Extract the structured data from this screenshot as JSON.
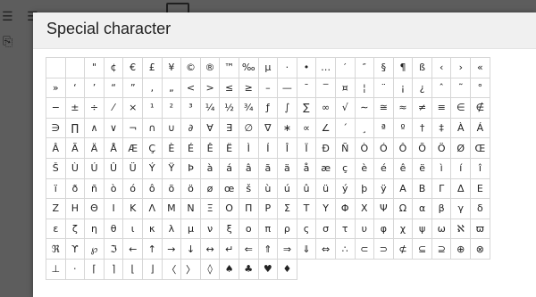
{
  "dialog": {
    "title": "Special character"
  },
  "characters": [
    "",
    "",
    "\"",
    "¢",
    "€",
    "£",
    "¥",
    "©",
    "®",
    "™",
    "‰",
    "µ",
    "·",
    "•",
    "…",
    "′",
    "″",
    "§",
    "¶",
    "ß",
    "‹",
    "›",
    "«",
    "»",
    "‘",
    "’",
    "“",
    "”",
    "‚",
    "„",
    "<",
    ">",
    "≤",
    "≥",
    "–",
    "—",
    "¯",
    "‾",
    "¤",
    "¦",
    "¨",
    "¡",
    "¿",
    "ˆ",
    "˜",
    "°",
    "−",
    "±",
    "÷",
    "⁄",
    "×",
    "¹",
    "²",
    "³",
    "¼",
    "½",
    "¾",
    "ƒ",
    "∫",
    "∑",
    "∞",
    "√",
    "∼",
    "≅",
    "≈",
    "≠",
    "≡",
    "∈",
    "∉",
    "∋",
    "∏",
    "∧",
    "∨",
    "¬",
    "∩",
    "∪",
    "∂",
    "∀",
    "∃",
    "∅",
    "∇",
    "∗",
    "∝",
    "∠",
    "´",
    "¸",
    "ª",
    "º",
    "†",
    "‡",
    "À",
    "Á",
    "Â",
    "Ã",
    "Ä",
    "Å",
    "Æ",
    "Ç",
    "È",
    "É",
    "Ê",
    "Ë",
    "Ì",
    "Í",
    "Î",
    "Ï",
    "Ð",
    "Ñ",
    "Ò",
    "Ó",
    "Ô",
    "Õ",
    "Ö",
    "Ø",
    "Œ",
    "Š",
    "Ù",
    "Ú",
    "Û",
    "Ü",
    "Ý",
    "Ÿ",
    "Þ",
    "à",
    "á",
    "â",
    "ã",
    "ä",
    "å",
    "æ",
    "ç",
    "è",
    "é",
    "ê",
    "ë",
    "ì",
    "í",
    "î",
    "ï",
    "ð",
    "ñ",
    "ò",
    "ó",
    "ô",
    "õ",
    "ö",
    "ø",
    "œ",
    "š",
    "ù",
    "ú",
    "û",
    "ü",
    "ý",
    "þ",
    "ÿ",
    "Α",
    "Β",
    "Γ",
    "Δ",
    "Ε",
    "Ζ",
    "Η",
    "Θ",
    "Ι",
    "Κ",
    "Λ",
    "Μ",
    "Ν",
    "Ξ",
    "Ο",
    "Π",
    "Ρ",
    "Σ",
    "Τ",
    "Υ",
    "Φ",
    "Χ",
    "Ψ",
    "Ω",
    "α",
    "β",
    "γ",
    "δ",
    "ε",
    "ζ",
    "η",
    "θ",
    "ι",
    "κ",
    "λ",
    "μ",
    "ν",
    "ξ",
    "ο",
    "π",
    "ρ",
    "ς",
    "σ",
    "τ",
    "υ",
    "φ",
    "χ",
    "ψ",
    "ω",
    "ℵ",
    "ϖ",
    "ℜ",
    "ϒ",
    "℘",
    "ℑ",
    "←",
    "↑",
    "→",
    "↓",
    "↔",
    "↵",
    "⇐",
    "⇑",
    "⇒",
    "⇓",
    "⇔",
    "∴",
    "⊂",
    "⊃",
    "⊄",
    "⊆",
    "⊇",
    "⊕",
    "⊗",
    "⊥",
    "⋅",
    "⌈",
    "⌉",
    "⌊",
    "⌋",
    "〈",
    "〉",
    "◊",
    "♠",
    "♣",
    "♥",
    "♦"
  ]
}
